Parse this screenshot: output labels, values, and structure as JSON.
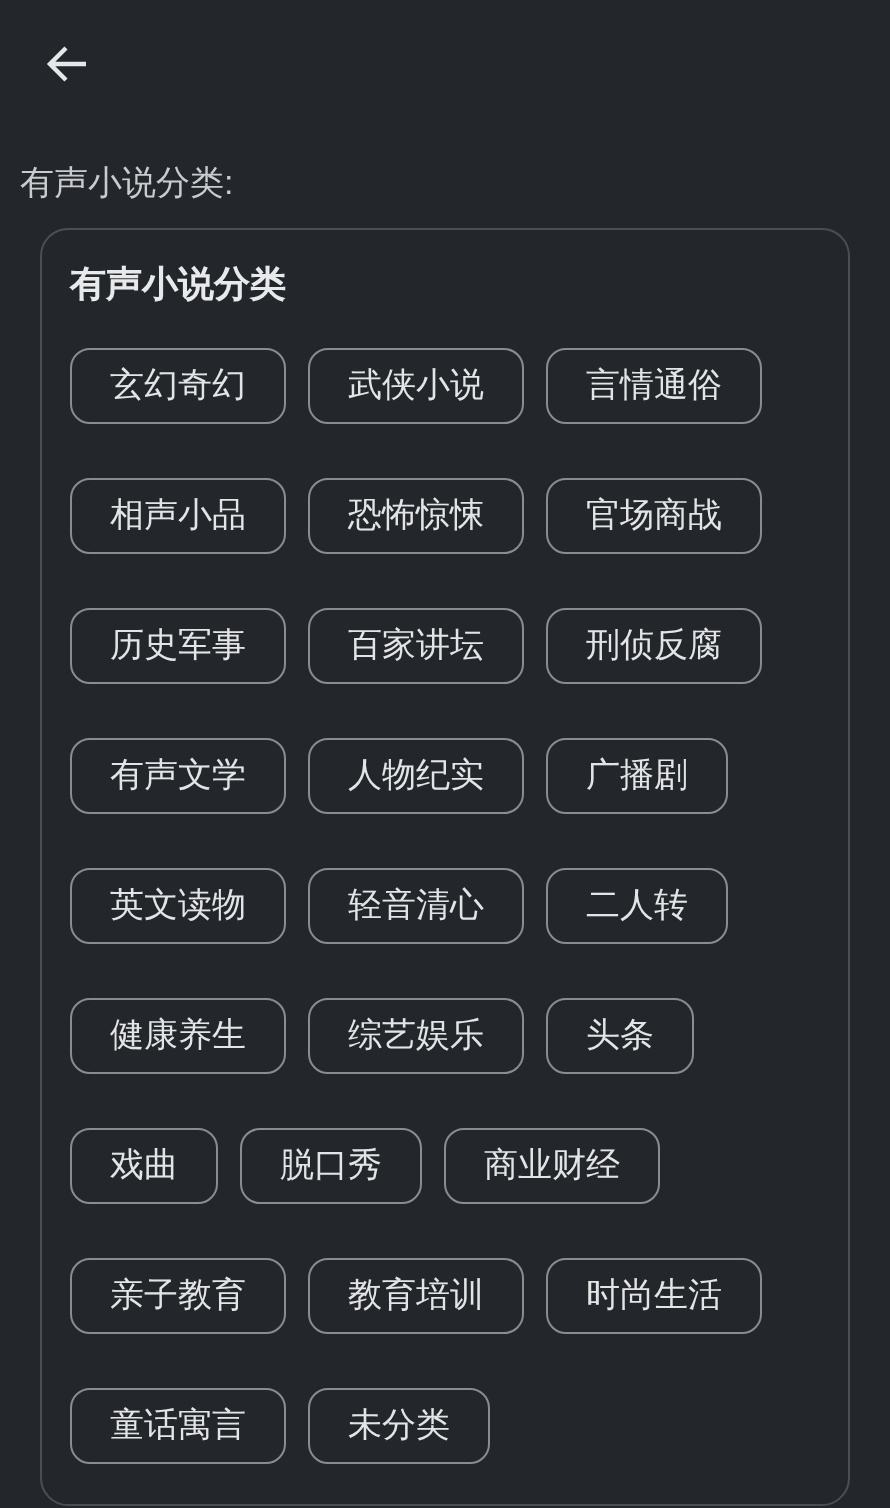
{
  "label": "有声小说分类:",
  "card": {
    "title": "有声小说分类",
    "tags": [
      "玄幻奇幻",
      "武侠小说",
      "言情通俗",
      "相声小品",
      "恐怖惊悚",
      "官场商战",
      "历史军事",
      "百家讲坛",
      "刑侦反腐",
      "有声文学",
      "人物纪实",
      "广播剧",
      "英文读物",
      "轻音清心",
      "二人转",
      "健康养生",
      "综艺娱乐",
      "头条",
      "戏曲",
      "脱口秀",
      "商业财经",
      "亲子教育",
      "教育培训",
      "时尚生活",
      "童话寓言",
      "未分类"
    ]
  }
}
